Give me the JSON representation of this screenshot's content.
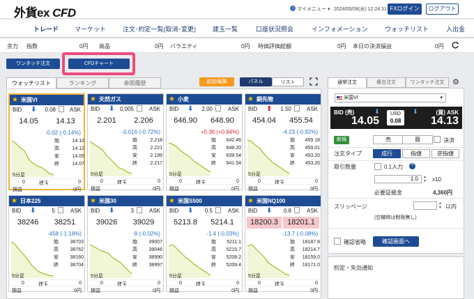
{
  "header": {
    "logo_main": "外貨ex",
    "logo_cfd": "CFD",
    "user_menu": "マイメニュー",
    "datetime": "2024/05/08(水) 12:24:31",
    "fx_login": "FXログイン",
    "logout": "ログアウト"
  },
  "nav": [
    "トレード",
    "マーケット",
    "注文･約定一覧(取消･変更)",
    "建玉一覧",
    "口座状況照会",
    "インフォメーション",
    "ウォッチリスト",
    "入出金"
  ],
  "summary": {
    "yoryoku": "余力",
    "shisu_label": "指数",
    "shisu_value": "0円",
    "shohin_label": "商品",
    "shohin_value": "0円",
    "variety_label": "バラエティ",
    "variety_value": "0円",
    "jika_label": "時価評価総額",
    "jika_value": "0円",
    "kessai_label": "本日の決済損益",
    "kessai_value": "0円"
  },
  "buttons": {
    "onetouch": "ワンタッチ注文",
    "cfd_chart": "CFDチャート",
    "add_edit": "追加/編集",
    "panel": "パネル",
    "list": "リスト"
  },
  "tabs": [
    "ウォッチリスト",
    "ランキング",
    "参照履歴"
  ],
  "labels": {
    "bid": "BID",
    "ask": "ASK",
    "open": "始",
    "high": "高",
    "low": "安",
    "close": "終",
    "bar5": "5分足",
    "tategyoku": "建玉",
    "soneki": "損益"
  },
  "cards": [
    {
      "name": "米国VI",
      "dir": "dn",
      "spread": "0.08",
      "bid": "14.05",
      "ask": "14.13",
      "change": "-0.02 (-0.14%)",
      "o": "14.10",
      "h": "14.12",
      "l": "14.05",
      "c": "14.07",
      "pos_left": "0",
      "pos_right": "0",
      "pl": "0円",
      "hl": false,
      "sel": true
    },
    {
      "name": "天然ガス",
      "dir": "dn",
      "spread": "0.005",
      "bid": "2.201",
      "ask": "2.206",
      "change": "-0.016 (-0.72%)",
      "o": "2.218",
      "h": "2.221",
      "l": "2.199",
      "c": "2.217",
      "pos_left": "0",
      "pos_right": "0",
      "pl": "0円",
      "hl": false,
      "sel": false
    },
    {
      "name": "小麦",
      "dir": "dn",
      "spread": "2.00",
      "bid": "646.90",
      "ask": "648.90",
      "change": "+5.36 (+0.84%)",
      "o": "642.46",
      "h": "648.20",
      "l": "639.54",
      "c": "641.54",
      "pos_left": "0",
      "pos_right": "0",
      "pl": "0円",
      "hl": false,
      "sel": false
    },
    {
      "name": "銅先物",
      "dir": "up",
      "spread": "1.50",
      "bid": "454.04",
      "ask": "455.54",
      "change": "-4.23 (-0.92%)",
      "o": "459.18",
      "h": "459.01",
      "l": "453.20",
      "c": "453.20",
      "pos_left": "0",
      "pos_right": "0",
      "pl": "0円",
      "hl": false,
      "sel": false
    },
    {
      "name": "日本225",
      "dir": "dn",
      "spread": "5",
      "bid": "38246",
      "ask": "38251",
      "change": "-458 (-1.18%)",
      "o": "38703",
      "h": "38762",
      "l": "38160",
      "c": "38704",
      "pos_left": "0",
      "pos_right": "0",
      "pl": "0円",
      "hl": false,
      "sel": false
    },
    {
      "name": "米国30",
      "dir": "dn",
      "spread": "3",
      "bid": "39026",
      "ask": "39029",
      "change": "-9 (-0.02%)",
      "o": "39007",
      "h": "39046",
      "l": "38990",
      "c": "38997",
      "pos_left": "0",
      "pos_right": "0",
      "pl": "0円",
      "hl": false,
      "sel": false
    },
    {
      "name": "米国S500",
      "dir": "dn",
      "spread": "0.5",
      "bid": "5213.8",
      "ask": "5214.1",
      "change": "-1.4 (-0.03%)",
      "o": "5211.1",
      "h": "5215.7",
      "l": "5208.2",
      "c": "5209.4",
      "pos_left": "0",
      "pos_right": "0",
      "pl": "0円",
      "hl": false,
      "sel": false
    },
    {
      "name": "米国NQ100",
      "dir": "dn",
      "spread": "0.8",
      "bid": "18200.3",
      "ask": "18201.1",
      "change": "-13.7 (-0.08%)",
      "o": "18187.8",
      "h": "18214.7",
      "l": "18159.0",
      "c": "18171.0",
      "pos_left": "0",
      "pos_right": "0",
      "pl": "0円",
      "hl": true,
      "sel": false
    }
  ],
  "order": {
    "tabs": [
      "通常注文",
      "複合注文",
      "ワンタッチ注文"
    ],
    "symbol": "米国VI",
    "bid_label": "BID (売)",
    "bid": "14.05",
    "ask_label": "(買) ASK",
    "ask": "14.13",
    "usd": "USD",
    "spread": "0.08",
    "new": "新規",
    "sell": "売",
    "buy": "買",
    "settle": "決済",
    "order_type": "注文タイプ",
    "market": "成行",
    "limit": "指値",
    "stop": "逆指値",
    "qty_label": "取引数量",
    "lot": "0.1入力",
    "qty": "1.0",
    "mult": "x10",
    "margin_label": "必要証拠金",
    "margin": "4,360円",
    "slippage": "スリッページ",
    "within": "以内",
    "slip_note": "(空欄時は制限無し)",
    "skip_confirm": "確認省略",
    "confirm": "確認画面へ",
    "notice": "約定・失効通知"
  }
}
